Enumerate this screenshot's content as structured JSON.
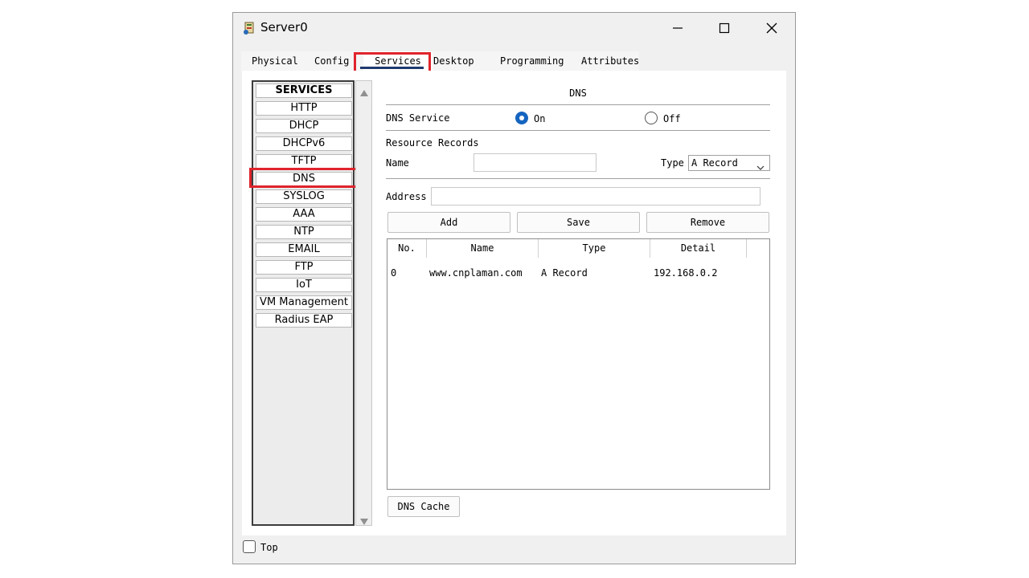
{
  "window": {
    "title": "Server0",
    "controls": [
      "minimize-icon",
      "maximize-icon",
      "close-icon"
    ]
  },
  "tabs": [
    "Physical",
    "Config",
    "Services",
    "Desktop",
    "Programming",
    "Attributes"
  ],
  "selected_tab": "Services",
  "services": {
    "header": "SERVICES",
    "items": [
      "HTTP",
      "DHCP",
      "DHCPv6",
      "TFTP",
      "DNS",
      "SYSLOG",
      "AAA",
      "NTP",
      "EMAIL",
      "FTP",
      "IoT",
      "VM Management",
      "Radius EAP"
    ],
    "selected": "DNS"
  },
  "dns": {
    "title": "DNS",
    "service_label": "DNS Service",
    "on_label": "On",
    "off_label": "Off",
    "service_state": "On",
    "resource_records_label": "Resource Records",
    "name_label": "Name",
    "name_value": "",
    "type_label": "Type",
    "type_value": "A Record",
    "address_label": "Address",
    "address_value": "",
    "buttons": {
      "add": "Add",
      "save": "Save",
      "remove": "Remove"
    },
    "table": {
      "columns": [
        "No.",
        "Name",
        "Type",
        "Detail"
      ],
      "rows": [
        {
          "no": "0",
          "name": "www.cnplaman.com",
          "type": "A Record",
          "detail": "192.168.0.2"
        }
      ]
    },
    "cache_button": "DNS Cache"
  },
  "footer": {
    "top_label": "Top",
    "top_checked": false
  },
  "colors": {
    "highlight": "#e0242c",
    "radio_selected": "#1565c0",
    "tab_underline": "#1f3a6e"
  }
}
